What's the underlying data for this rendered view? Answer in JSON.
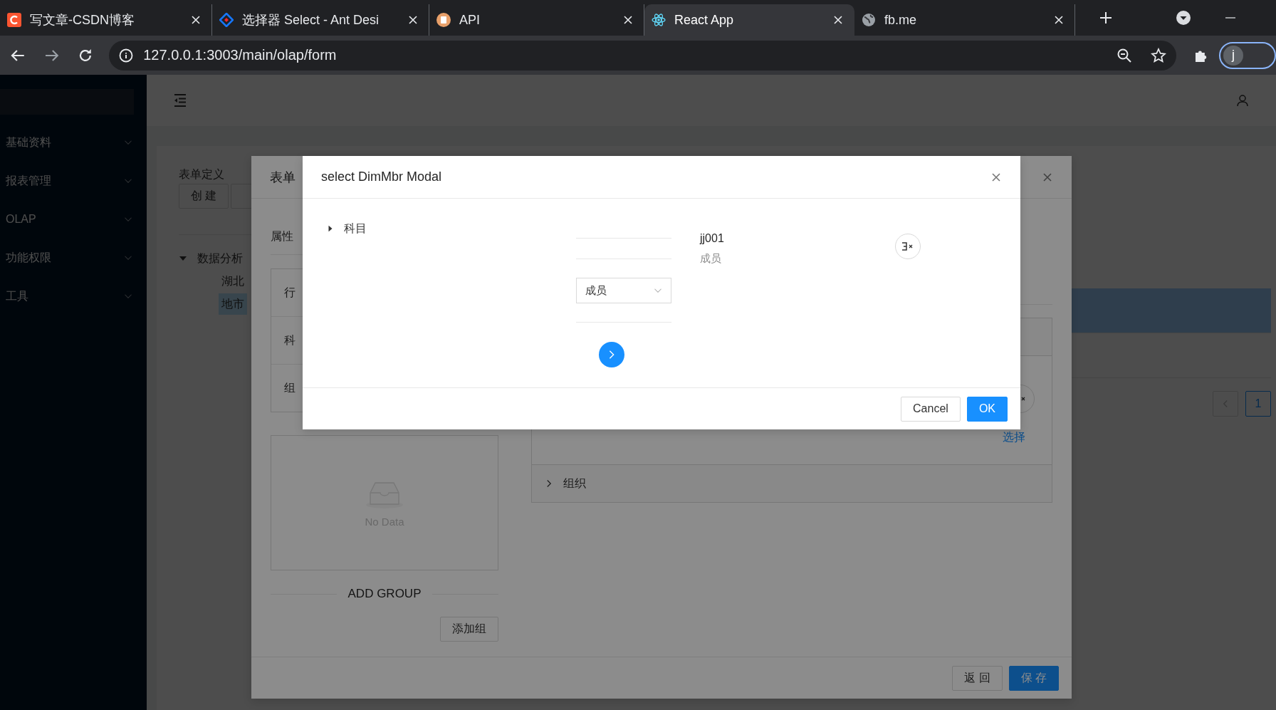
{
  "browser": {
    "tabs": [
      {
        "title": "写文章-CSDN博客",
        "kind": "csdn",
        "selected": false
      },
      {
        "title": "选择器 Select - Ant Desi",
        "kind": "ant",
        "selected": false
      },
      {
        "title": "API",
        "kind": "doc",
        "selected": false
      },
      {
        "title": "React App",
        "kind": "react",
        "selected": true
      },
      {
        "title": "fb.me",
        "kind": "globe",
        "selected": false
      }
    ],
    "url": "127.0.0.1:3003/main/olap/form",
    "profile_initial": "j"
  },
  "sidebar": {
    "items": [
      {
        "label": "基础资料"
      },
      {
        "label": "报表管理"
      },
      {
        "label": "OLAP"
      },
      {
        "label": "功能权限"
      },
      {
        "label": "工具"
      }
    ]
  },
  "page": {
    "title": "表单定义",
    "buttons": [
      "创 建"
    ],
    "tree": [
      {
        "label": "数据分析",
        "expanded": true,
        "children": [
          {
            "label": "湖北",
            "selected": false
          },
          {
            "label": "地市",
            "selected": true
          }
        ]
      }
    ],
    "table": {
      "rows": [
        {
          "selected": true
        },
        {
          "selected": false
        }
      ]
    },
    "pagination": {
      "pages": [
        {
          "label": "1",
          "selected": true
        }
      ]
    }
  },
  "form_modal": {
    "title": "表单",
    "section_label": "属性",
    "list": [
      "行",
      "科",
      "组"
    ],
    "empty_text": "No Data",
    "divider_title": "ADD GROUP",
    "add_button": "添加组",
    "link": "选择",
    "panels": [
      {
        "label": "组织",
        "expanded": false
      }
    ],
    "footer_buttons": [
      {
        "label": "返 回",
        "kind": "default"
      },
      {
        "label": "保 存",
        "kind": "primary"
      }
    ]
  },
  "member_modal": {
    "title": "select DimMbr Modal",
    "tree": [
      {
        "label": "科目",
        "expanded": false
      }
    ],
    "select": {
      "value": "成员"
    },
    "member": {
      "code": "jj001",
      "type": "成员"
    },
    "footer_buttons": [
      {
        "label": "Cancel",
        "kind": "default"
      },
      {
        "label": "OK",
        "kind": "primary"
      }
    ]
  }
}
